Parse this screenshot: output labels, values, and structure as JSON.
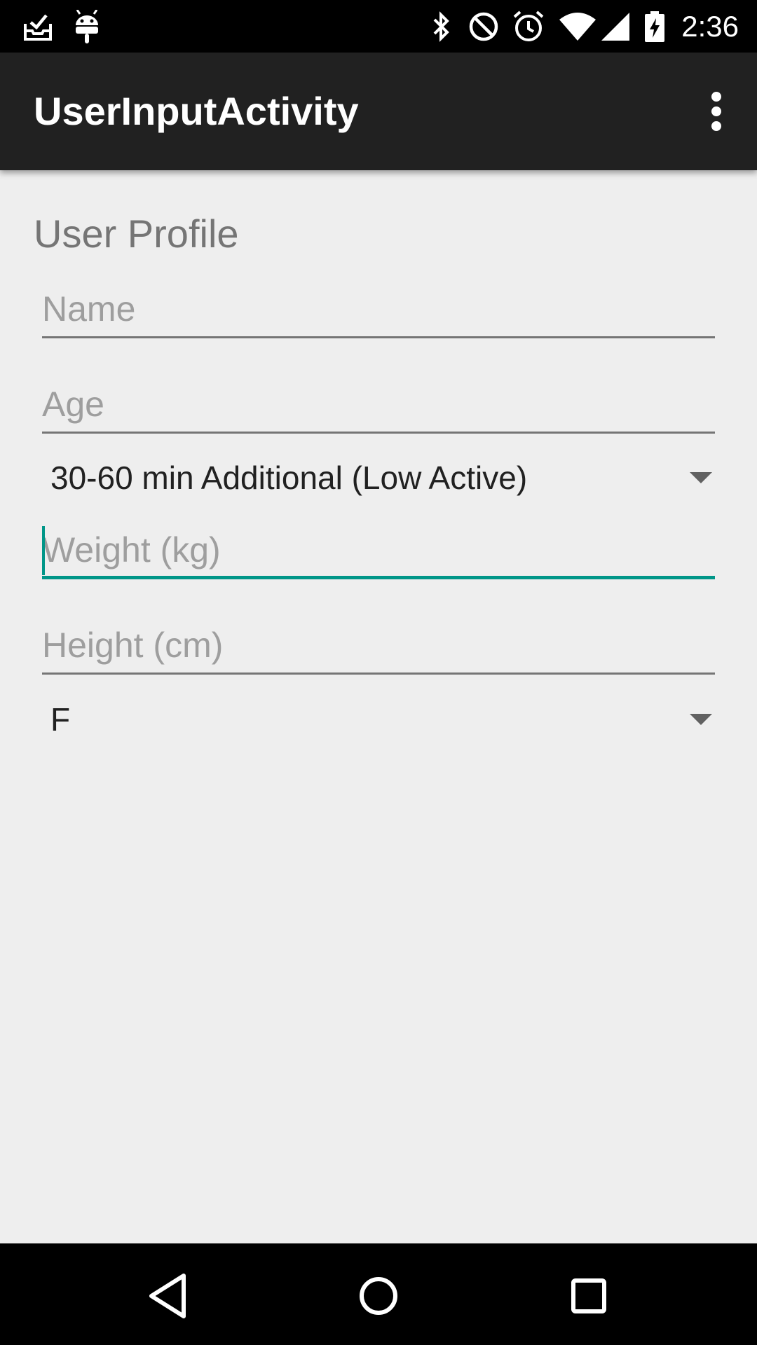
{
  "status_bar": {
    "time": "2:36",
    "icons": [
      "inbox-check-icon",
      "android-icon",
      "bluetooth-icon",
      "do-not-disturb-icon",
      "alarm-icon",
      "wifi-icon",
      "signal-icon",
      "battery-charging-icon"
    ]
  },
  "app_bar": {
    "title": "UserInputActivity",
    "overflow_icon": "more-vert-icon"
  },
  "form": {
    "section_title": "User Profile",
    "name_placeholder": "Name",
    "name_value": "",
    "age_placeholder": "Age",
    "age_value": "",
    "activity_selected": "30-60 min Additional (Low Active)",
    "weight_placeholder": "Weight (kg)",
    "weight_value": "",
    "height_placeholder": "Height (cm)",
    "height_value": "",
    "sex_selected": "F"
  },
  "colors": {
    "accent": "#009688",
    "app_bar": "#212121",
    "background": "#eeeeee"
  },
  "nav_bar": {
    "icons": [
      "back-icon",
      "home-icon",
      "recents-icon"
    ]
  }
}
